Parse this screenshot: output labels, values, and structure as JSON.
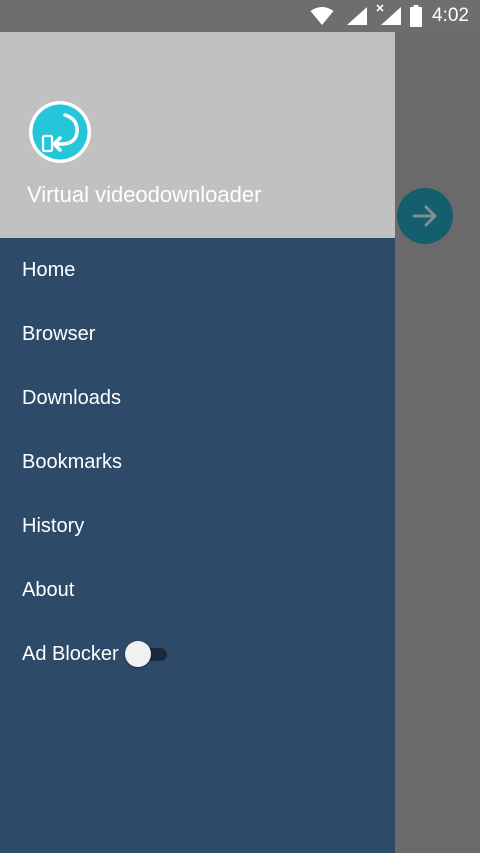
{
  "status_bar": {
    "time": "4:02",
    "icons": [
      "wifi-icon",
      "signal-icon",
      "signal-no-data-icon",
      "battery-icon"
    ]
  },
  "drawer": {
    "app_name": "Virtual videodownloader",
    "logo_icon": "video-download-logo-icon",
    "menu": [
      {
        "label": "Home"
      },
      {
        "label": "Browser"
      },
      {
        "label": "Downloads"
      },
      {
        "label": "Bookmarks"
      },
      {
        "label": "History"
      },
      {
        "label": "About"
      }
    ],
    "ad_blocker": {
      "label": "Ad Blocker",
      "enabled": false
    }
  },
  "fab": {
    "icon": "arrow-right-icon"
  },
  "colors": {
    "drawer_bg": "#2d4a69",
    "header_bg": "#c1c1c1",
    "scrim": "#6a6a6a",
    "logo_accent": "#26c6da",
    "fab_bg": "#155e6e"
  }
}
